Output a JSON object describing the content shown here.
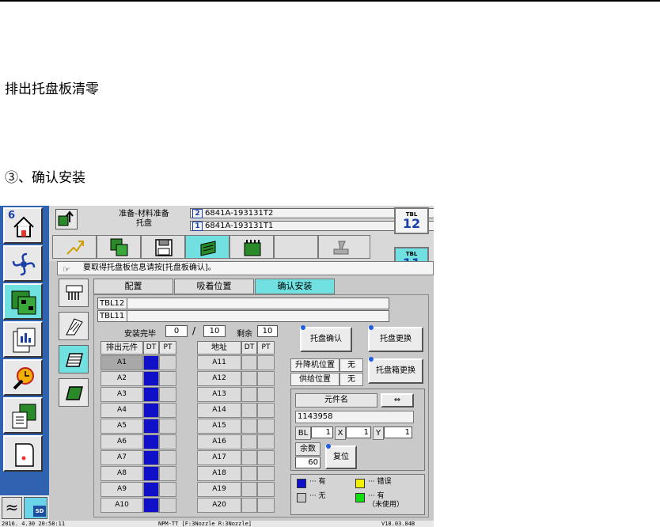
{
  "doc": {
    "heading1": "排出托盘板清零",
    "heading2": "③、确认安装"
  },
  "screen": {
    "leftnav": {
      "home_number": "6"
    },
    "topbar": {
      "title_line1": "准备-材料准备",
      "title_line2": "托盘",
      "tbl_rows": [
        {
          "index": "2",
          "text": "6841A-193131T2"
        },
        {
          "index": "1",
          "text": "6841A-193131T1"
        }
      ],
      "tbl_badges": [
        {
          "label": "TBL",
          "number": "12"
        },
        {
          "label": "TBL",
          "number": "11"
        }
      ]
    },
    "message": "要取得托盘板信息请按[托盘板确认]。",
    "tabs": [
      "配置",
      "吸着位置",
      "确认安装"
    ],
    "active_tab": 2,
    "panel": {
      "tbl12_label": "TBL12",
      "tbl11_label": "TBL11",
      "install_done_label": "安装完毕",
      "install_done_value": "0",
      "slash": "/",
      "install_total": "10",
      "remaining_label": "剩余",
      "remaining_value": "10",
      "col_eject": "排出元件",
      "col_dt": "DT",
      "col_pt": "PT",
      "col_address": "地址",
      "left_rows": [
        "A1",
        "A2",
        "A3",
        "A4",
        "A5",
        "A6",
        "A7",
        "A8",
        "A9",
        "A10"
      ],
      "right_rows": [
        "A11",
        "A12",
        "A13",
        "A14",
        "A15",
        "A16",
        "A17",
        "A18",
        "A19",
        "A20"
      ],
      "tray_confirm": "托盘确认",
      "tray_replace": "托盘更换",
      "tray_box_replace": "托盘箱更换",
      "lift_position_label": "升降机位置",
      "lift_position_value": "无",
      "supply_position_label": "供给位置",
      "supply_position_value": "无",
      "component_name_label": "元件名",
      "swap_icon_glyph": "⇔",
      "component_name_value": "1143958",
      "bl_label": "BL",
      "bl_value": "1",
      "x_label": "X",
      "x_value": "1",
      "y_label": "Y",
      "y_value": "1",
      "remaining_count_label": "余数",
      "remaining_count_value": "60",
      "reset_button": "复位",
      "legend": [
        {
          "color": "#1010c8",
          "text": "··· 有"
        },
        {
          "color": "#f0f000",
          "text": "··· 错误"
        },
        {
          "color": "#c8c8c8",
          "text": "··· 无"
        },
        {
          "color": "#10e010",
          "text": "··· 有\n（未使用）"
        }
      ]
    },
    "statusbar": {
      "datetime": "2016. 4.30 20:58:11",
      "machine": "NPM-TT [F:3Nozzle  R:3Nozzle]",
      "version": "V18.03.84B"
    }
  }
}
